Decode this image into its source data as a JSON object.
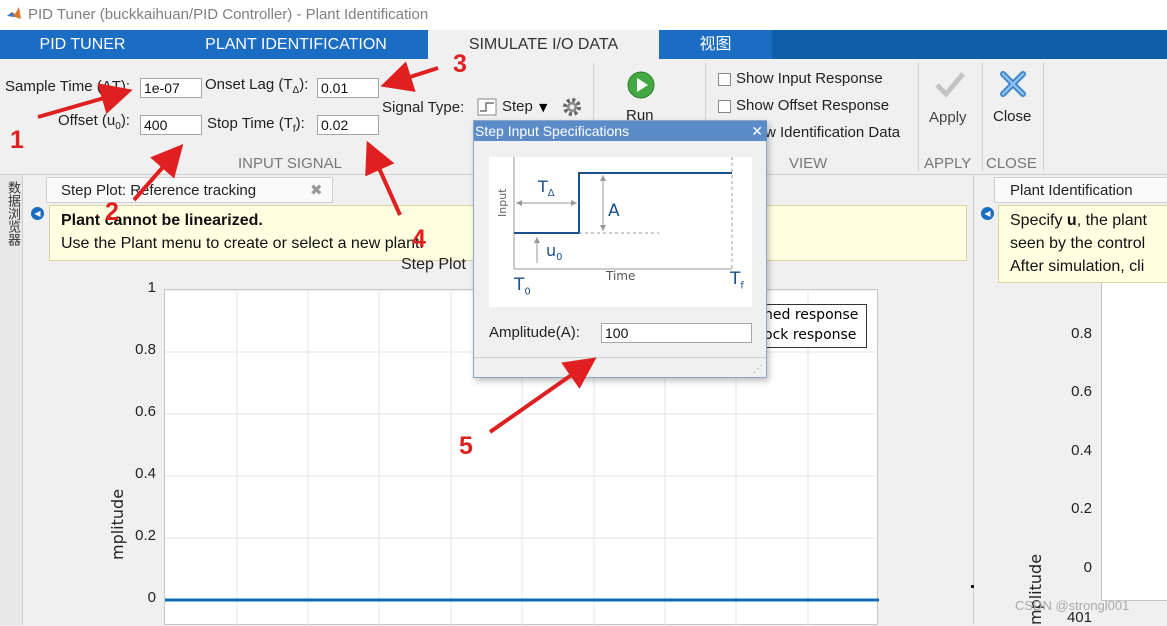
{
  "window": {
    "title": "PID Tuner (buckkaihuan/PID Controller) - Plant Identification"
  },
  "tabs": [
    {
      "label": "PID TUNER"
    },
    {
      "label": "PLANT IDENTIFICATION"
    },
    {
      "label": "SIMULATE I/O DATA"
    },
    {
      "label": "视图"
    }
  ],
  "input_signal": {
    "sample_time_label": "Sample Time (ΔT):",
    "sample_time_value": "1e-07",
    "onset_lag_label": "Onset Lag (T",
    "onset_lag_sub": "Δ",
    "onset_lag_value": "0.01",
    "offset_label": "Offset (u",
    "offset_sub": "0",
    "offset_value": "400",
    "stop_time_label": "Stop Time (T",
    "stop_time_sub": "f",
    "stop_time_value": "0.02",
    "label_suffix": "):",
    "signal_type_label": "Signal Type:",
    "signal_type_value": "Step",
    "section_label": "INPUT SIGNAL"
  },
  "run": {
    "label": "Run"
  },
  "view": {
    "show_input": "Show Input Response",
    "show_offset": "Show Offset Response",
    "show_ident": "w Identification Data",
    "section_label": "VIEW"
  },
  "apply": {
    "label": "Apply",
    "section_label": "APPLY"
  },
  "close": {
    "label": "Close",
    "section_label": "CLOSE"
  },
  "side_panel": {
    "label": "数据浏览器"
  },
  "step_plot": {
    "tab_label": "Step Plot: Reference tracking",
    "warn_title": "Plant cannot be linearized.",
    "warn_text": "Use the Plant menu to create or select a new plant.",
    "title": "Step Plot",
    "ylabel": "mplitude",
    "legend": [
      "ned response",
      "ock response"
    ],
    "yticks": [
      "1",
      "0.8",
      "0.6",
      "0.4",
      "0.2",
      "0"
    ]
  },
  "plant_ident": {
    "tab_label": "Plant Identification",
    "line1_pre": "Specify ",
    "line1_bold": "u",
    "line1_post": ", the plant",
    "line2": "seen by the control",
    "line3": "After simulation, cli",
    "yticks": [
      "0.8",
      "0.6",
      "0.4",
      "0.2",
      "0"
    ],
    "ylabel": "mplitude",
    "bottom_tick": "401"
  },
  "dialog": {
    "title": "Step Input Specifications",
    "diagram": {
      "input_label": "Input",
      "time_label": "Time",
      "t_delta": "T",
      "t_delta_sub": "Δ",
      "a_label": "A",
      "u0": "u",
      "u0_sub": "0",
      "t0": "T",
      "t0_sub": "0",
      "tf": "T",
      "tf_sub": "f"
    },
    "amplitude_label": "Amplitude(A):",
    "amplitude_value": "100"
  },
  "annotations": [
    "1",
    "2",
    "3",
    "4",
    "5"
  ],
  "watermark": "CSDN @strongl001",
  "colors": {
    "tab_blue": "#1b6cc3",
    "tab_dark": "#0f5ea9",
    "annotation_red": "#e02020",
    "plot_line": "#0a6cb4"
  }
}
